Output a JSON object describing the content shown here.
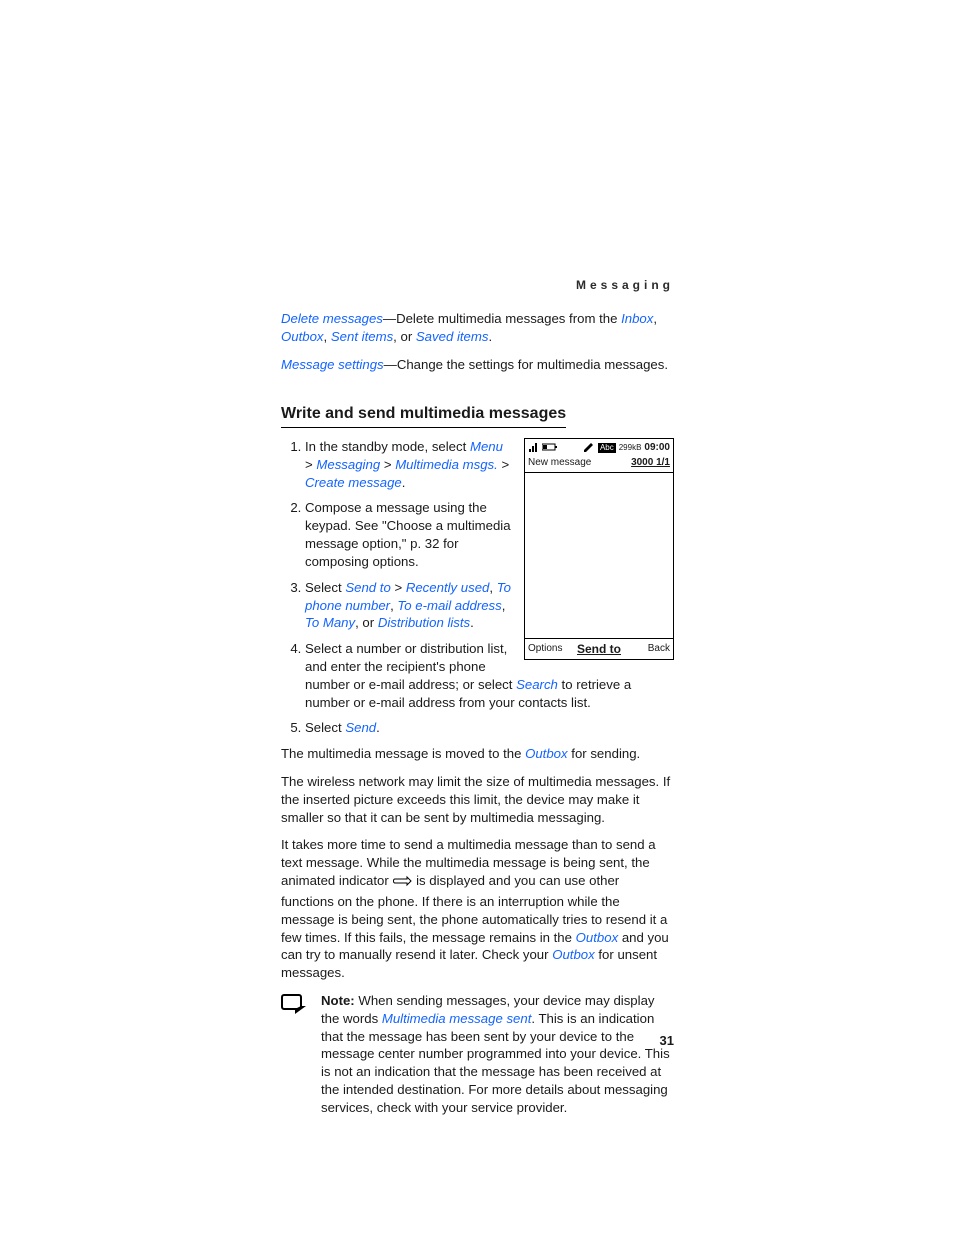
{
  "running_head": "Messaging",
  "intro": {
    "delete_link": "Delete messages",
    "delete_text1": "—Delete multimedia messages from the ",
    "inbox_link": "Inbox",
    "outbox_link": "Outbox",
    "sentitems_link": "Sent items",
    "delete_text2": ", or ",
    "saveditems_link": "Saved items",
    "delete_end": ".",
    "settings_link": "Message settings",
    "settings_text": "—Change the settings for multimedia messages."
  },
  "section_heading": "Write and send multimedia messages",
  "steps": {
    "s1_a": "In the standby mode, select ",
    "s1_menu": "Menu",
    "s1_gt1": " > ",
    "s1_messaging": "Messaging",
    "s1_gt2": " > ",
    "s1_multimsgs": "Multimedia msgs.",
    "s1_gt3": " > ",
    "s1_create": "Create message",
    "s1_end": ".",
    "s2": "Compose a message using the keypad. See \"Choose a multimedia message option,\" p. 32 for composing options.",
    "s3_a": "Select ",
    "s3_sendto": "Send to",
    "s3_gt": " > ",
    "s3_recent": "Recently used",
    "s3_tophone": "To phone number",
    "s3_toemail": "To e-mail address",
    "s3_tomany": "To Many",
    "s3_or": ", or ",
    "s3_dlists": "Distribution lists",
    "s3_end": ".",
    "s4_a": "Select a number or distribution list, and enter the recipient's phone number or e-mail address; or select ",
    "s4_search": "Search",
    "s4_b": " to retrieve a number or e-mail address from your contacts list.",
    "s5_a": "Select ",
    "s5_send": "Send",
    "s5_end": "."
  },
  "after_steps": {
    "p1_a": "The multimedia message is moved to the ",
    "p1_outbox": "Outbox",
    "p1_b": " for sending.",
    "p2": "The wireless network may limit the size of multimedia messages. If the inserted picture exceeds this limit, the device may make it smaller so that it can be sent by multimedia messaging.",
    "p3_a": "It takes more time to send a multimedia message than to send a text message. While the multimedia message is being sent, the animated indicator ",
    "p3_b": " is displayed and you can use other functions on the phone. If there is an interruption while the message is being sent, the phone automatically tries to resend it a few times. If this fails, the message remains in the ",
    "p3_outbox1": "Outbox",
    "p3_c": " and you can try to manually resend it later. Check your ",
    "p3_outbox2": "Outbox",
    "p3_d": " for unsent messages."
  },
  "note": {
    "label": "Note:",
    "text_a": " When sending messages, your device may display the words ",
    "link": "Multimedia message sent",
    "text_b": ". This is an indication that the message has been sent by your device to the message center number programmed into your device. This is not an indication that the message has been received at the intended destination. For more details about messaging services, check with your service provider."
  },
  "figure": {
    "abc": "Abc",
    "size": "299kB",
    "time": "09:00",
    "title_left": "New message",
    "title_right": "3000 1/1",
    "softkey_left": "Options",
    "softkey_center": "Send to",
    "softkey_right": "Back"
  },
  "page_number": "31"
}
